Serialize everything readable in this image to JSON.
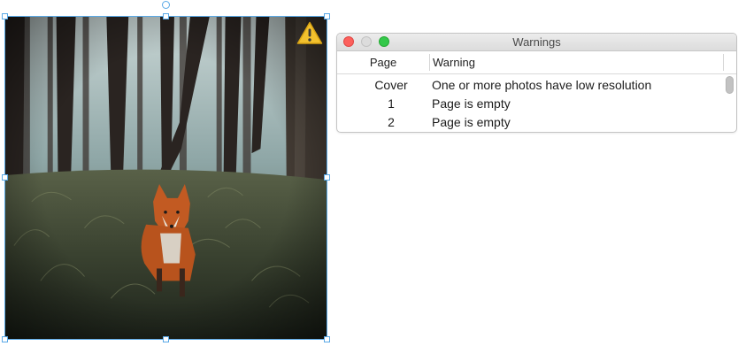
{
  "panel": {
    "title": "Warnings",
    "columns": {
      "page": "Page",
      "warning": "Warning"
    },
    "rows": [
      {
        "page": "Cover",
        "warning": "One or more photos have low resolution"
      },
      {
        "page": "1",
        "warning": "Page is empty"
      },
      {
        "page": "2",
        "warning": "Page is empty"
      }
    ]
  },
  "photo": {
    "warning_icon": "warning-triangle-icon"
  },
  "colors": {
    "selection": "#5aa9e6",
    "warning_yellow": "#f2c12e",
    "close": "#fc605c",
    "maximize": "#34c84a"
  }
}
